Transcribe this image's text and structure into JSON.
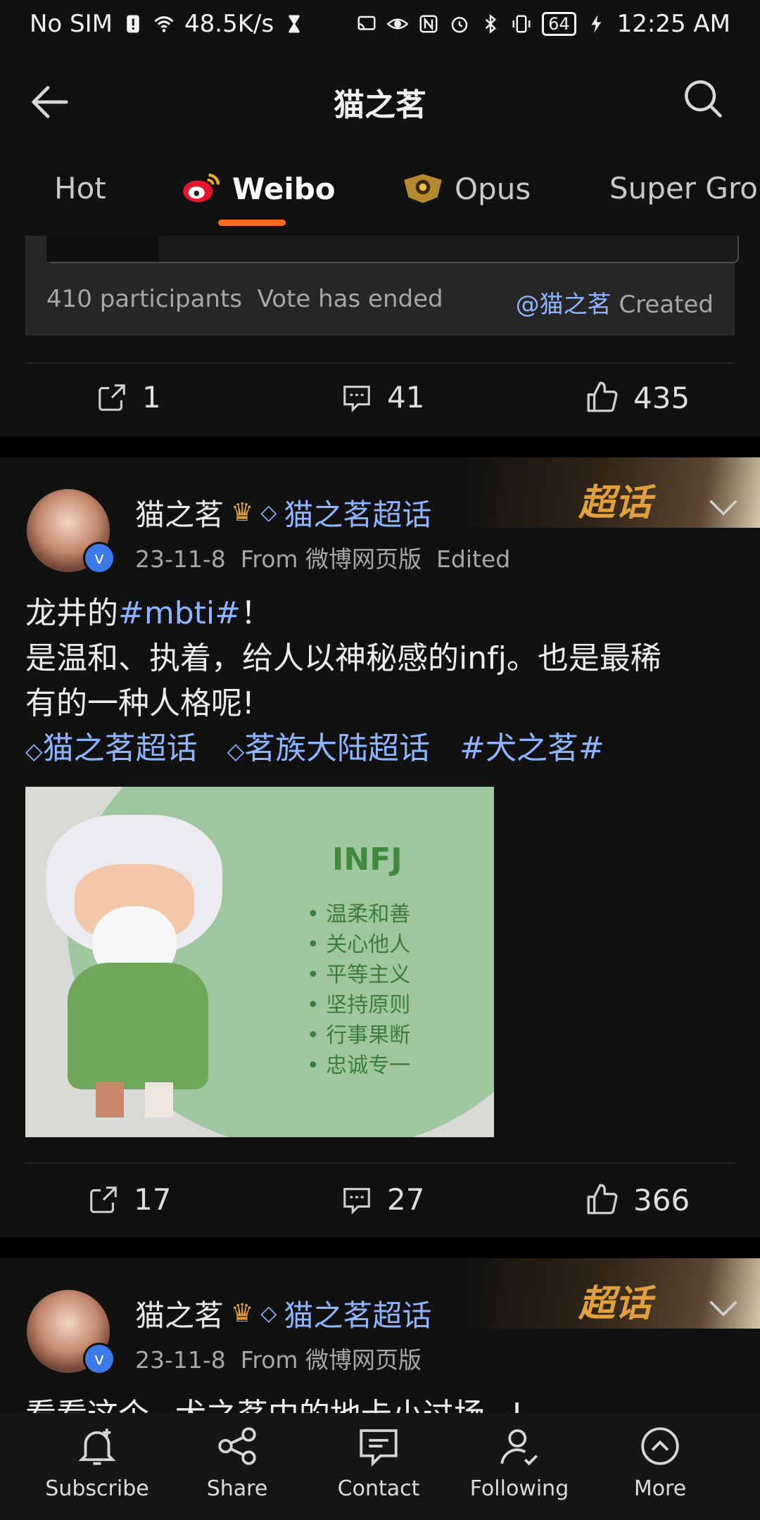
{
  "status": {
    "carrier": "No SIM",
    "speed": "48.5K/s",
    "battery": "64",
    "time": "12:25 AM"
  },
  "header": {
    "title": "猫之茗"
  },
  "tabs": [
    {
      "label": "Hot"
    },
    {
      "label": "Weibo"
    },
    {
      "label": "Opus"
    },
    {
      "label": "Super Grou"
    }
  ],
  "vote": {
    "participants": "410 participants",
    "status": "Vote has ended",
    "creator": "@猫之茗",
    "created": "Created"
  },
  "post0_actions": {
    "share": "1",
    "comments": "41",
    "likes": "435"
  },
  "post1": {
    "name": "猫之茗",
    "topic": "猫之茗超话",
    "date": "23-11-8",
    "source": "From 微博网页版",
    "edited": "Edited",
    "badge": "超话",
    "text_line1_prefix": "龙井的",
    "text_line1_tag": "#mbti#",
    "text_line1_suffix": "！",
    "text_line2": "是温和、执着，给人以神秘感的infj。也是最稀",
    "text_line3": "有的一种人格呢!",
    "topic_link1": "猫之茗超话",
    "topic_link2": "茗族大陆超话",
    "topic_link3": "#犬之茗#",
    "image": {
      "heading": "INFJ",
      "bullets": [
        "温柔和善",
        "关心他人",
        "平等主义",
        "坚持原则",
        "行事果断",
        "忠诚专一"
      ]
    },
    "actions": {
      "share": "17",
      "comments": "27",
      "likes": "366"
    }
  },
  "post2": {
    "name": "猫之茗",
    "topic": "猫之茗超话",
    "date": "23-11-8",
    "source": "From 微博网页版",
    "badge": "超话",
    "text_partial": "看看这个~犬之茗中的地卡小过场~!"
  },
  "bottom": [
    {
      "label": "Subscribe",
      "icon": "bell-plus-icon"
    },
    {
      "label": "Share",
      "icon": "share-nodes-icon"
    },
    {
      "label": "Contact",
      "icon": "chat-bubble-icon"
    },
    {
      "label": "Following",
      "icon": "user-check-icon"
    },
    {
      "label": "More",
      "icon": "chevron-up-circle-icon"
    }
  ],
  "colors": {
    "accent": "#ff6a1f",
    "link": "#8fb4ff",
    "gold": "#e0a040"
  }
}
